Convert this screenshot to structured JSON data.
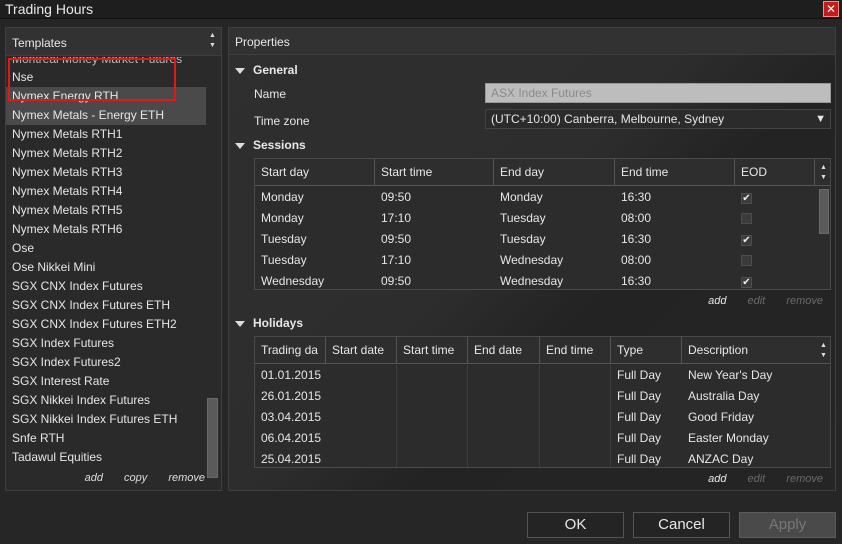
{
  "window": {
    "title": "Trading Hours",
    "close_icon": "close-icon"
  },
  "templates": {
    "header": "Templates",
    "cut_item": "Montreal Money Market Futures",
    "items": [
      "Nse",
      "Nymex Energy RTH",
      "Nymex Metals - Energy ETH",
      "Nymex Metals RTH1",
      "Nymex Metals RTH2",
      "Nymex Metals RTH3",
      "Nymex Metals RTH4",
      "Nymex Metals RTH5",
      "Nymex Metals RTH6",
      "Ose",
      "Ose Nikkei Mini",
      "SGX CNX Index Futures",
      "SGX CNX Index Futures ETH",
      "SGX CNX Index Futures ETH2",
      "SGX Index Futures",
      "SGX Index Futures2",
      "SGX Interest Rate",
      "SGX Nikkei Index Futures",
      "SGX Nikkei Index Futures ETH",
      "Snfe RTH",
      "Tadawul Equities"
    ],
    "selected": [
      "Nymex Energy RTH",
      "Nymex Metals - Energy ETH"
    ],
    "actions": {
      "add": "add",
      "copy": "copy",
      "remove": "remove"
    }
  },
  "properties": {
    "header": "Properties",
    "general": {
      "title": "General",
      "name_label": "Name",
      "name_value": "ASX Index Futures",
      "timezone_label": "Time zone",
      "timezone_value": "(UTC+10:00) Canberra, Melbourne, Sydney"
    },
    "sessions": {
      "title": "Sessions",
      "columns": [
        "Start day",
        "Start time",
        "End day",
        "End time",
        "EOD"
      ],
      "rows": [
        {
          "start_day": "Monday",
          "start_time": "09:50",
          "end_day": "Monday",
          "end_time": "16:30",
          "eod": true
        },
        {
          "start_day": "Monday",
          "start_time": "17:10",
          "end_day": "Tuesday",
          "end_time": "08:00",
          "eod": false
        },
        {
          "start_day": "Tuesday",
          "start_time": "09:50",
          "end_day": "Tuesday",
          "end_time": "16:30",
          "eod": true
        },
        {
          "start_day": "Tuesday",
          "start_time": "17:10",
          "end_day": "Wednesday",
          "end_time": "08:00",
          "eod": false
        },
        {
          "start_day": "Wednesday",
          "start_time": "09:50",
          "end_day": "Wednesday",
          "end_time": "16:30",
          "eod": true
        }
      ],
      "actions": {
        "add": "add",
        "edit": "edit",
        "remove": "remove"
      }
    },
    "holidays": {
      "title": "Holidays",
      "columns": [
        "Trading da",
        "Start date",
        "Start time",
        "End date",
        "End time",
        "Type",
        "Description"
      ],
      "rows": [
        {
          "trading_day": "01.01.2015",
          "type": "Full Day",
          "description": "New Year's Day"
        },
        {
          "trading_day": "26.01.2015",
          "type": "Full Day",
          "description": "Australia Day"
        },
        {
          "trading_day": "03.04.2015",
          "type": "Full Day",
          "description": "Good Friday"
        },
        {
          "trading_day": "06.04.2015",
          "type": "Full Day",
          "description": "Easter Monday"
        },
        {
          "trading_day": "25.04.2015",
          "type": "Full Day",
          "description": "ANZAC Day"
        }
      ],
      "actions": {
        "add": "add",
        "edit": "edit",
        "remove": "remove"
      }
    }
  },
  "buttons": {
    "ok": "OK",
    "cancel": "Cancel",
    "apply": "Apply"
  },
  "colors": {
    "selection_frame": "#e01818",
    "close_button": "#c41c1c",
    "name_input_bg": "#bdbdbd"
  }
}
